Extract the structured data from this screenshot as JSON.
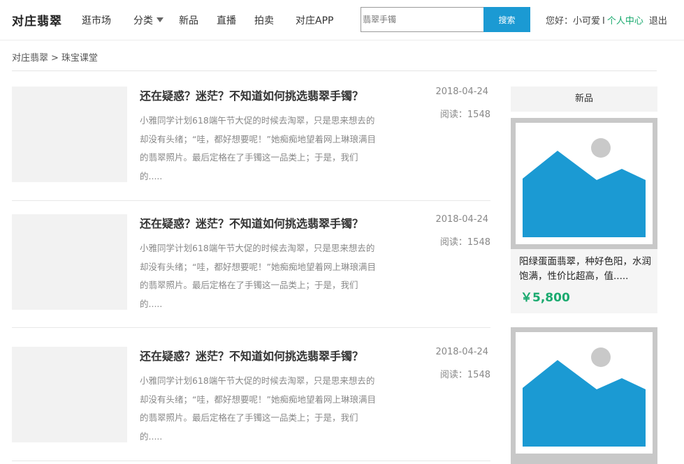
{
  "header": {
    "logo": "对庄翡翠",
    "nav": [
      "逛市场",
      "分类",
      "新品",
      "直播",
      "拍卖",
      "对庄APP"
    ],
    "search": {
      "placeholder": "翡翠手镯",
      "button": "搜索"
    },
    "user": {
      "greeting": "您好：小可爱",
      "separator": "I",
      "center": "个人中心",
      "logout": "退出"
    }
  },
  "breadcrumb": {
    "home": "对庄翡翠",
    "separator": ">",
    "current": "珠宝课堂"
  },
  "articles": [
    {
      "title": "还在疑惑？迷茫？不知道如何挑选翡翠手镯？",
      "excerpt": "小雅同学计划618端午节大促的时候去淘翠，只是思来想去的却没有头绪；“哇，都好想要呢！”她痴痴地望着网上琳琅满目的翡翠照片。最后定格在了手镯这一品类上；于是，我们的.....",
      "date": "2018-04-24",
      "reads": "阅读：1548"
    },
    {
      "title": "还在疑惑？迷茫？不知道如何挑选翡翠手镯？",
      "excerpt": "小雅同学计划618端午节大促的时候去淘翠，只是思来想去的却没有头绪；“哇，都好想要呢！”她痴痴地望着网上琳琅满目的翡翠照片。最后定格在了手镯这一品类上；于是，我们的.....",
      "date": "2018-04-24",
      "reads": "阅读：1548"
    },
    {
      "title": "还在疑惑？迷茫？不知道如何挑选翡翠手镯？",
      "excerpt": "小雅同学计划618端午节大促的时候去淘翠，只是思来想去的却没有头绪；“哇，都好想要呢！”她痴痴地望着网上琳琅满目的翡翠照片。最后定格在了手镯这一品类上；于是，我们的.....",
      "date": "2018-04-24",
      "reads": "阅读：1548"
    }
  ],
  "sidebar": {
    "title": "新品",
    "products": [
      {
        "name": "阳绿蛋面翡翠，种好色阳，水润饱满，性价比超高，值.....",
        "price": "￥5,800",
        "image_icon": "image-placeholder-icon"
      },
      {
        "name": "",
        "price": "",
        "image_icon": "image-placeholder-icon"
      }
    ]
  },
  "colors": {
    "accent": "#1b9ad3",
    "price": "#1aaa6f",
    "link": "#1aaa6f"
  }
}
